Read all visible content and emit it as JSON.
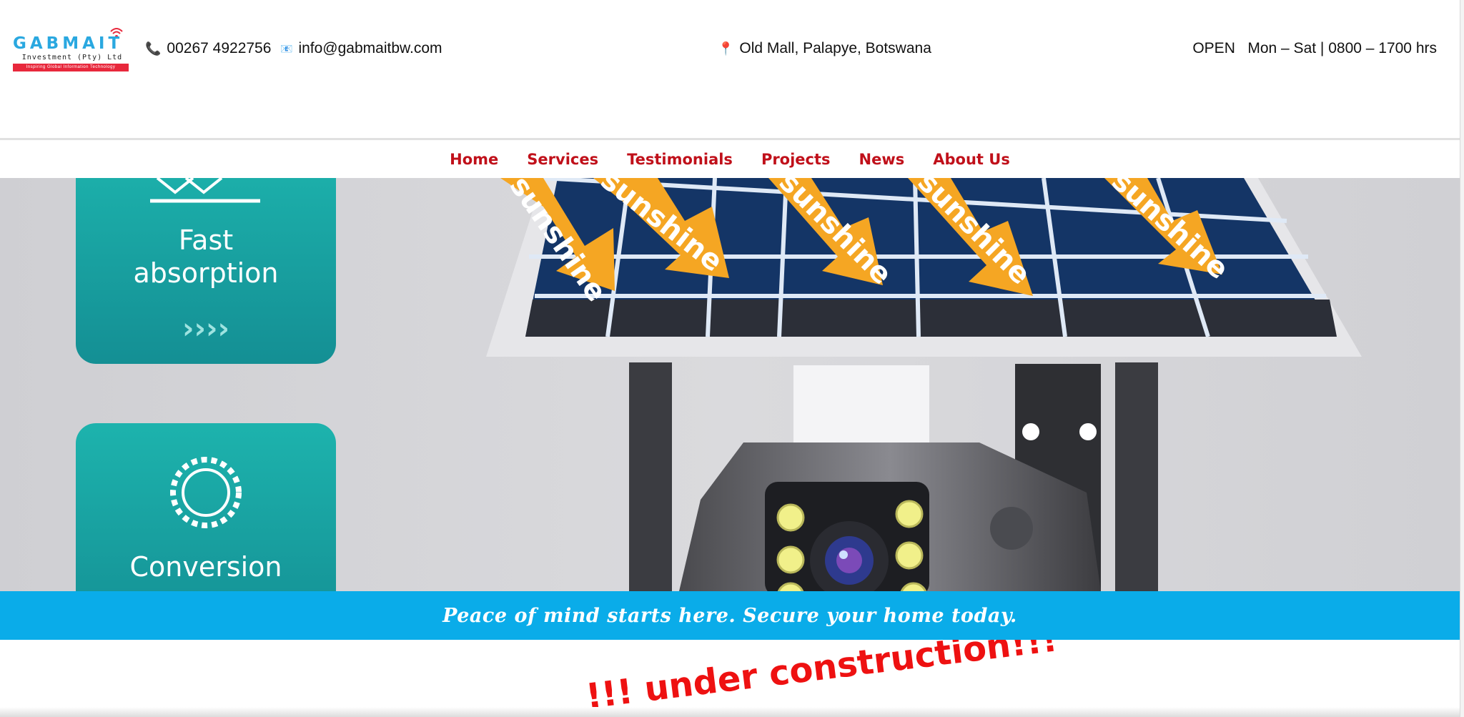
{
  "header": {
    "logo": {
      "name": "GABMAIT",
      "subtitle": "Investment (Pty) Ltd",
      "tagline": "Inspiring Global Information Technology"
    },
    "phone": "00267 4922756",
    "email": "info@gabmaitbw.com",
    "location": "Old Mall, Palapye, Botswana",
    "hours": "OPEN   Mon – Sat | 0800 – 1700 hrs"
  },
  "nav": {
    "items": [
      {
        "label": "Home"
      },
      {
        "label": "Services"
      },
      {
        "label": "Testimonials"
      },
      {
        "label": "Projects"
      },
      {
        "label": "News"
      },
      {
        "label": "About Us"
      }
    ]
  },
  "hero": {
    "card1": "Fast",
    "card1b": "absorption",
    "card2": "Conversion",
    "arrow_label": "sunshine",
    "colors": {
      "panel": "#0f2a55",
      "arrow": "#f5a623",
      "card": "#17a6a2"
    }
  },
  "banner": {
    "text": "Peace of mind starts here. Secure your home today."
  },
  "construction": {
    "text": "!!! under construction!!!"
  },
  "colors": {
    "nav": "#c0101a",
    "banner": "#0aace9",
    "construction": "#ee1111"
  }
}
